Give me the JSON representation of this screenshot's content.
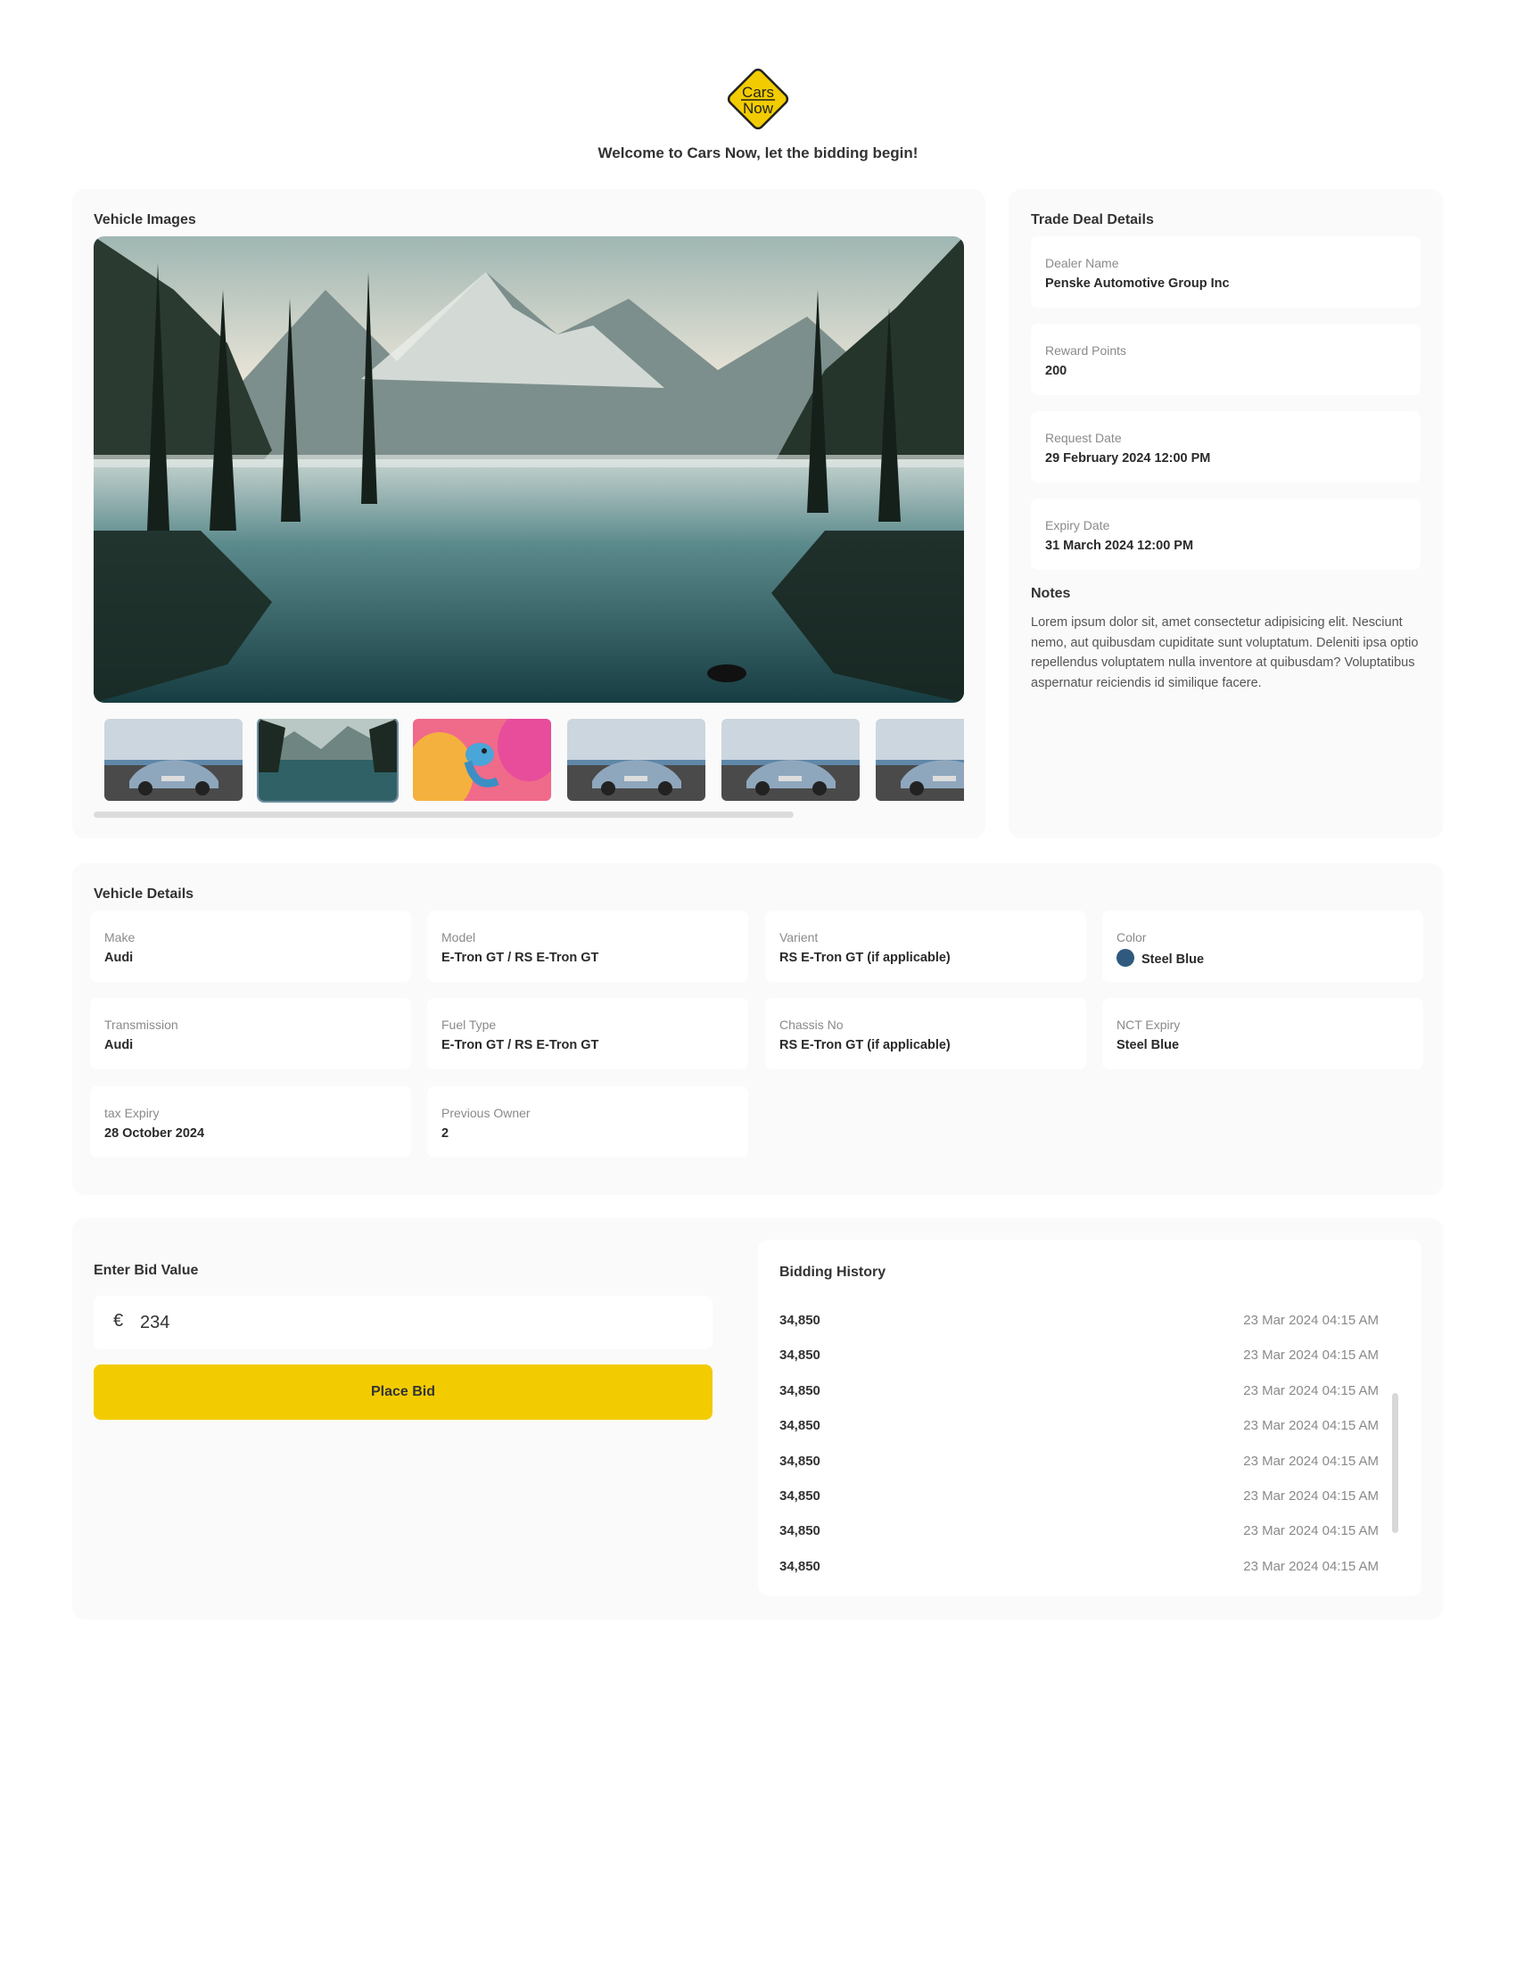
{
  "brand": {
    "logo_text_line1": "Cars",
    "logo_text_line2": "Now",
    "welcome": "Welcome to Cars Now, let the bidding begin!",
    "accent": "#f2cc00"
  },
  "vehicle_images": {
    "title": "Vehicle Images",
    "main_image": "mountain-lake-reflection",
    "thumbnails": [
      "audi-etron-gt-car",
      "mountain-lake-reflection",
      "chameleon-on-flower",
      "audi-etron-gt-car",
      "audi-etron-gt-car",
      "audi-etron-gt-car"
    ],
    "active_thumbnail_index": 1
  },
  "trade_deal": {
    "title": "Trade Deal Details",
    "fields": [
      {
        "label": "Dealer Name",
        "value": "Penske Automotive Group Inc"
      },
      {
        "label": "Reward Points",
        "value": "200"
      },
      {
        "label": "Request Date",
        "value": "29 February 2024 12:00 PM"
      },
      {
        "label": "Expiry Date",
        "value": "31 March 2024 12:00 PM"
      }
    ],
    "notes_title": "Notes",
    "notes": "Lorem ipsum dolor sit, amet consectetur adipisicing elit. Nesciunt nemo, aut quibusdam cupiditate sunt voluptatum. Deleniti ipsa optio repellendus voluptatem nulla inventore at quibusdam? Voluptatibus aspernatur reiciendis id similique facere."
  },
  "vehicle_details": {
    "title": "Vehicle Details",
    "fields": [
      {
        "label": "Make",
        "value": "Audi"
      },
      {
        "label": "Model",
        "value": "E-Tron GT / RS E-Tron GT"
      },
      {
        "label": "Varient",
        "value": "RS E-Tron GT (if applicable)"
      },
      {
        "label": "Color",
        "value": "Steel Blue",
        "swatch": "#2f5a7e"
      },
      {
        "label": "Transmission",
        "value": "Audi"
      },
      {
        "label": "Fuel Type",
        "value": "E-Tron GT / RS E-Tron GT"
      },
      {
        "label": "Chassis No",
        "value": "RS E-Tron GT (if applicable)"
      },
      {
        "label": "NCT Expiry",
        "value": "Steel Blue"
      },
      {
        "label": "tax Expiry",
        "value": "28 October 2024"
      },
      {
        "label": "Previous Owner",
        "value": "2"
      }
    ]
  },
  "bid": {
    "title": "Enter Bid Value",
    "currency": "€",
    "value": "234",
    "button": "Place Bid"
  },
  "history": {
    "title": "Bidding History",
    "rows": [
      {
        "amount": "34,850",
        "date": "23 Mar 2024 04:15 AM"
      },
      {
        "amount": "34,850",
        "date": "23 Mar 2024 04:15 AM"
      },
      {
        "amount": "34,850",
        "date": "23 Mar 2024 04:15 AM"
      },
      {
        "amount": "34,850",
        "date": "23 Mar 2024 04:15 AM"
      },
      {
        "amount": "34,850",
        "date": "23 Mar 2024 04:15 AM"
      },
      {
        "amount": "34,850",
        "date": "23 Mar 2024 04:15 AM"
      },
      {
        "amount": "34,850",
        "date": "23 Mar 2024 04:15 AM"
      },
      {
        "amount": "34,850",
        "date": "23 Mar 2024 04:15 AM"
      }
    ]
  }
}
